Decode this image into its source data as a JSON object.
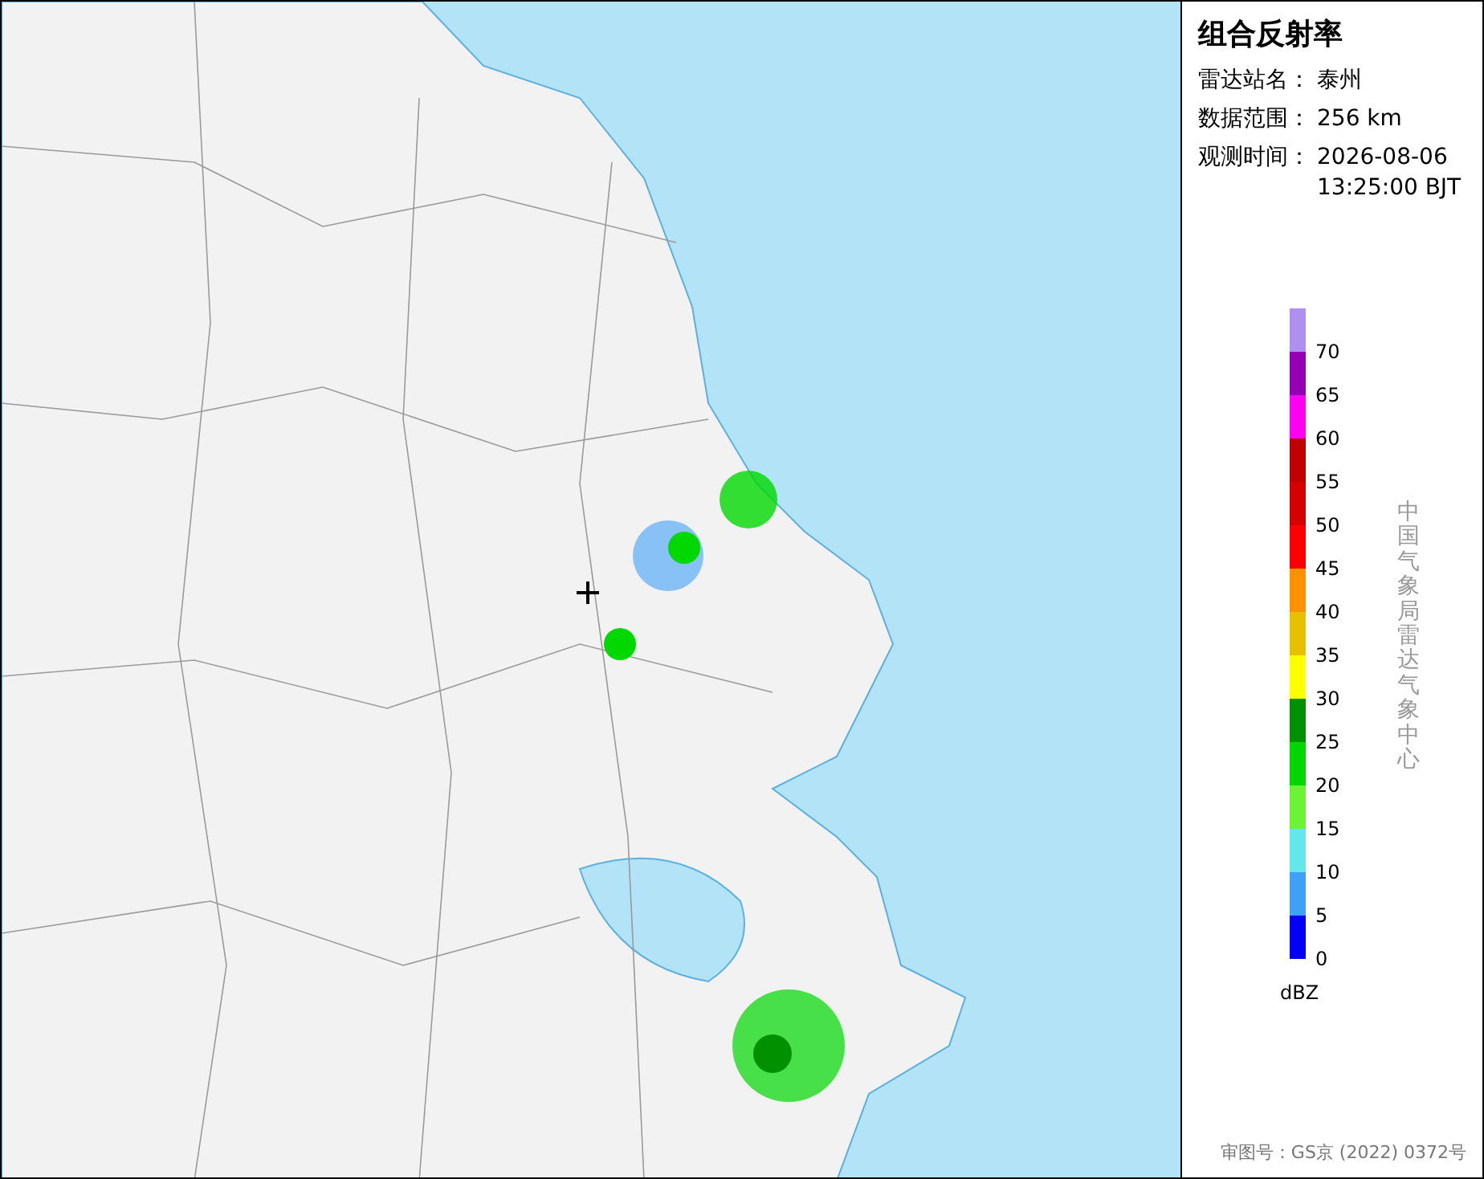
{
  "title": "组合反射率",
  "info": [
    {
      "label": "雷达站名：",
      "value": [
        "泰州"
      ]
    },
    {
      "label": "数据范围：",
      "value": [
        "256 km"
      ]
    },
    {
      "label": "观测时间：",
      "value": [
        "2026-08-06",
        "13:25:00 BJT"
      ]
    }
  ],
  "legend": [
    {
      "color": "#ad90f0",
      "label": "70"
    },
    {
      "color": "#9600b4",
      "label": "65"
    },
    {
      "color": "#ff00f0",
      "label": "60"
    },
    {
      "color": "#c00000",
      "label": "55"
    },
    {
      "color": "#d60000",
      "label": "50"
    },
    {
      "color": "#ff0000",
      "label": "45"
    },
    {
      "color": "#ff9000",
      "label": "40"
    },
    {
      "color": "#e7c000",
      "label": "35"
    },
    {
      "color": "#ffff00",
      "label": "30"
    },
    {
      "color": "#009000",
      "label": "25"
    },
    {
      "color": "#00d800",
      "label": "20"
    },
    {
      "color": "#6cf434",
      "label": "15"
    },
    {
      "color": "#64e7eb",
      "label": "10"
    },
    {
      "color": "#3fa0f6",
      "label": "5"
    },
    {
      "color": "#0000f6",
      "label": "0"
    }
  ],
  "unit": "dBZ",
  "credit": "中国气象局雷达气象中心",
  "approval": "审图号：GS京 (2022) 0372号"
}
